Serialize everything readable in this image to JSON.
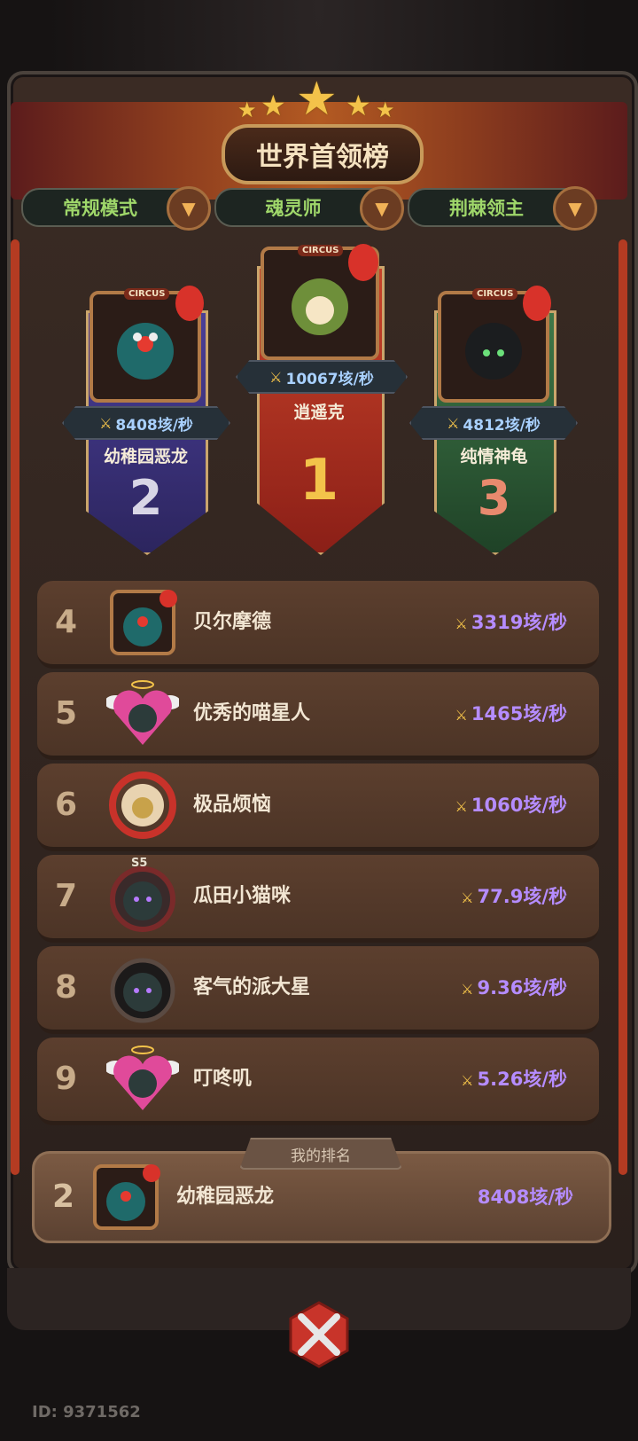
{
  "title": "世界首领榜",
  "tabs": [
    {
      "label": "常规模式"
    },
    {
      "label": "魂灵师"
    },
    {
      "label": "荆棘领主"
    }
  ],
  "podium": {
    "first": {
      "rank": "1",
      "name": "逍遥克",
      "score": "10067垓/秒",
      "badge": "CIRCUS"
    },
    "second": {
      "rank": "2",
      "name": "幼稚园恶龙",
      "score": "8408垓/秒",
      "badge": "CIRCUS"
    },
    "third": {
      "rank": "3",
      "name": "纯情神龟",
      "score": "4812垓/秒",
      "badge": "CIRCUS"
    }
  },
  "list": [
    {
      "rank": "4",
      "name": "贝尔摩德",
      "score": "3319垓/秒",
      "avatar": "circus-clown"
    },
    {
      "rank": "5",
      "name": "优秀的喵星人",
      "score": "1465垓/秒",
      "avatar": "winged-heart"
    },
    {
      "rank": "6",
      "name": "极品烦恼",
      "score": "1060垓/秒",
      "avatar": "festive-wreath"
    },
    {
      "rank": "7",
      "name": "瓜田小猫咪",
      "score": "77.9垓/秒",
      "avatar": "spiked-ring",
      "badge": "S5"
    },
    {
      "rank": "8",
      "name": "客气的派大星",
      "score": "9.36垓/秒",
      "avatar": "plain-ring"
    },
    {
      "rank": "9",
      "name": "叮咚叽",
      "score": "5.26垓/秒",
      "avatar": "winged-heart"
    }
  ],
  "my_rank": {
    "label": "我的排名",
    "rank": "2",
    "name": "幼稚园恶龙",
    "score": "8408垓/秒"
  },
  "footer": {
    "id": "ID: 9371562"
  },
  "icons": {
    "sword": "crossed-swords-icon",
    "dropdown": "chevron-down-icon",
    "battle": "crossed-swords-battle-icon"
  },
  "colors": {
    "score": "#b58cff",
    "tab_text": "#9fd76a",
    "gold": "#f3c34a",
    "first_banner": "#b5321f",
    "second_banner": "#3d3480",
    "third_banner": "#2f5a35"
  }
}
